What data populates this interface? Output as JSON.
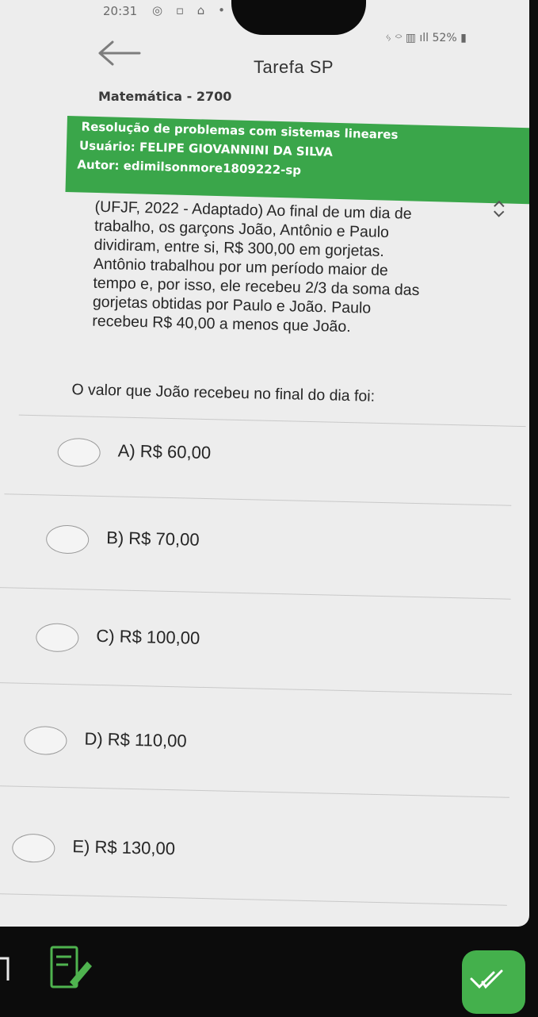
{
  "status": {
    "time": "20:31",
    "battery": "52%"
  },
  "header": {
    "title": "Tarefa SP",
    "back_icon": "arrow-left-icon"
  },
  "subject": "Matemática - 2700",
  "task": {
    "title": "Resolução de problemas com sistemas lineares",
    "user": "Usuário: FELIPE GIOVANNINI DA SILVA",
    "author": "Autor: edimilsonmore1809222-sp"
  },
  "question": {
    "lines": [
      "(UFJF, 2022 - Adaptado) Ao final de um dia de",
      "trabalho, os garçons João, Antônio e Paulo",
      "dividiram, entre si, R$ 300,00 em gorjetas.",
      "Antônio trabalhou por um período maior de",
      "tempo e, por isso, ele recebeu 2/3 da soma das",
      "gorjetas obtidas por Paulo e João. Paulo",
      "recebeu R$ 40,00 a menos que João."
    ],
    "prompt": "O valor que João recebeu no final do dia foi:"
  },
  "options": [
    {
      "label": "A) R$ 60,00"
    },
    {
      "label": "B) R$ 70,00"
    },
    {
      "label": "C) R$ 100,00"
    },
    {
      "label": "D) R$ 110,00"
    },
    {
      "label": "E) R$ 130,00"
    }
  ],
  "colors": {
    "accent_green": "#3aa64a",
    "fab_green": "#44b04c",
    "background": "#ededed"
  }
}
